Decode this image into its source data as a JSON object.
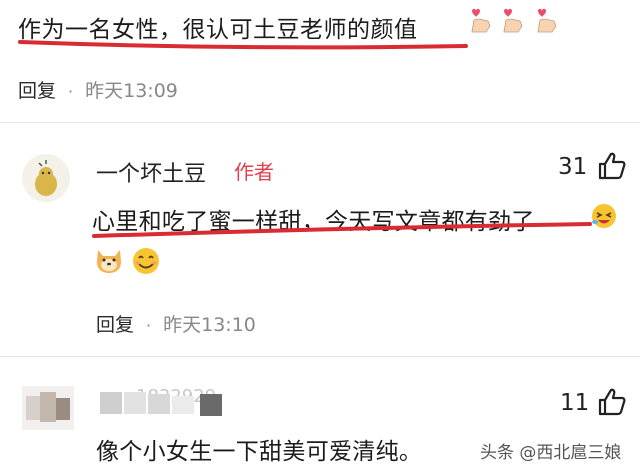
{
  "comments": [
    {
      "text": "作为一名女性，很认可土豆老师的颜值",
      "reply_label": "回复",
      "separator": "·",
      "time": "昨天13:09",
      "emoji": [
        "heart-hand-icon",
        "heart-hand-icon",
        "heart-hand-icon"
      ]
    },
    {
      "author": "一个坏土豆",
      "badge": "作者",
      "likes": "31",
      "text": "心里和吃了蜜一样甜，今天写文章都有劲了",
      "emoji": [
        "laughing-emoji-icon",
        "dog-emoji-icon",
        "smile-emoji-icon"
      ],
      "reply_label": "回复",
      "separator": "·",
      "time": "昨天13:10"
    },
    {
      "author_masked": "1832929",
      "likes": "11",
      "text": "像个小女生一下甜美可爱清纯。"
    }
  ],
  "watermark": "头条 @西北扈三娘",
  "colors": {
    "underline": "#d92b33",
    "badge": "#e0414a"
  }
}
